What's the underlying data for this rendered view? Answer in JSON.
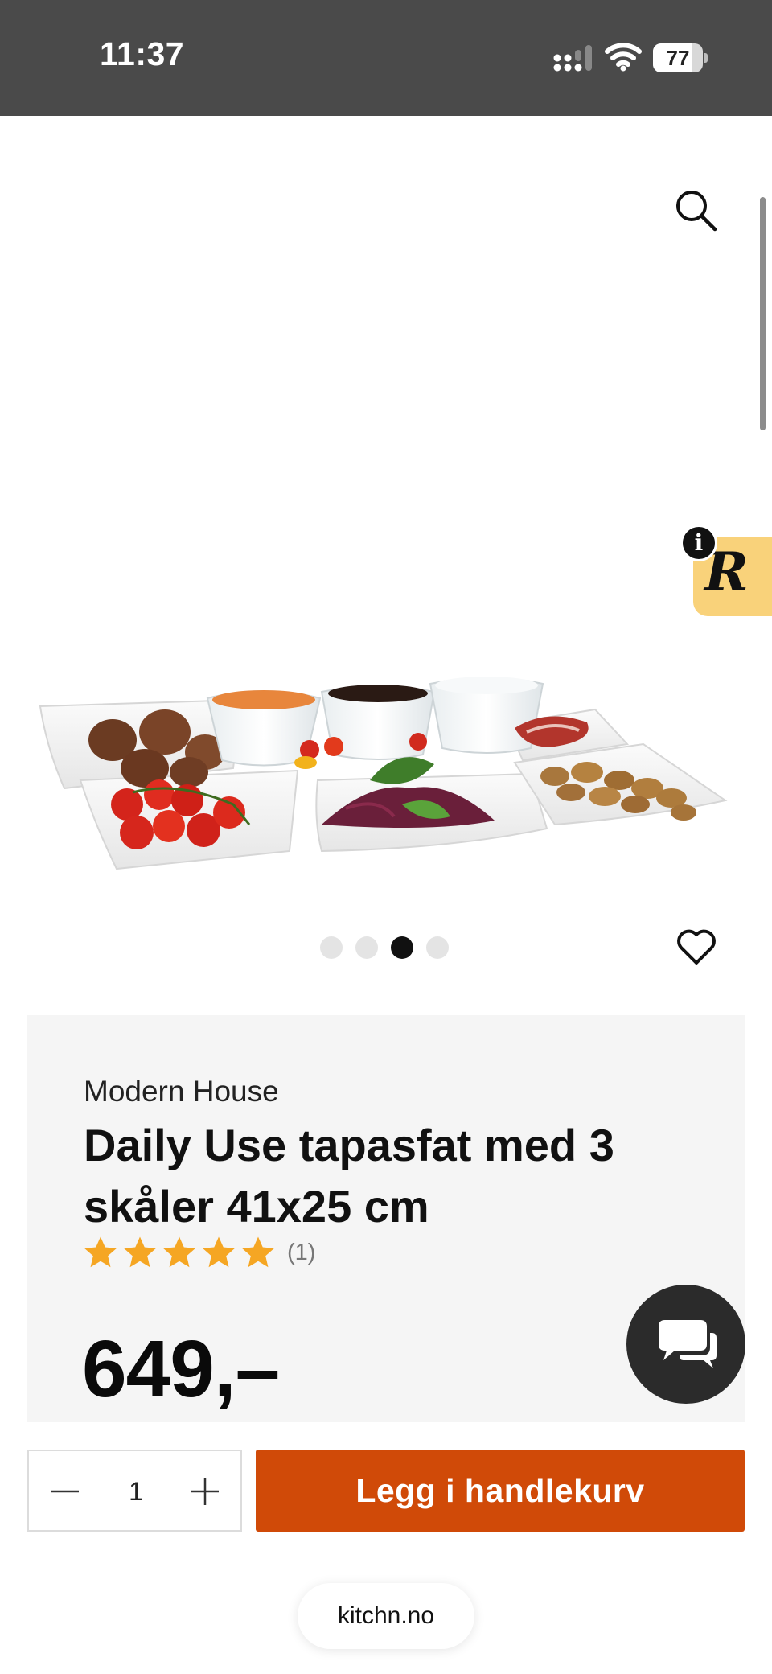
{
  "status_bar": {
    "time": "11:37",
    "battery_level": "77",
    "battery_fraction": 0.77,
    "icons": [
      "cellular-signal-icon",
      "wifi-icon",
      "battery-icon"
    ]
  },
  "header": {
    "search_icon": "search-icon"
  },
  "gallery": {
    "image_description_icon": "product-photo",
    "dots_total": 4,
    "active_index": 2,
    "favorite_icon": "heart-icon"
  },
  "widget": {
    "letter": "R",
    "info_label": "i"
  },
  "product": {
    "brand": "Modern House",
    "title": "Daily Use tapasfat med 3 skåler 41x25 cm",
    "rating_stars": 5,
    "rating_count": "(1)",
    "price": "649,–"
  },
  "purchase": {
    "quantity": "1",
    "add_to_cart_label": "Legg i handlekurv"
  },
  "browser": {
    "domain": "kitchn.no"
  },
  "colors": {
    "status_bar": "#4a4a4a",
    "accent": "#d04a08",
    "star": "#f5a623",
    "widget_bg": "#f9d27a",
    "card_bg": "#f5f5f5",
    "chat_bg": "#2b2b2b"
  }
}
